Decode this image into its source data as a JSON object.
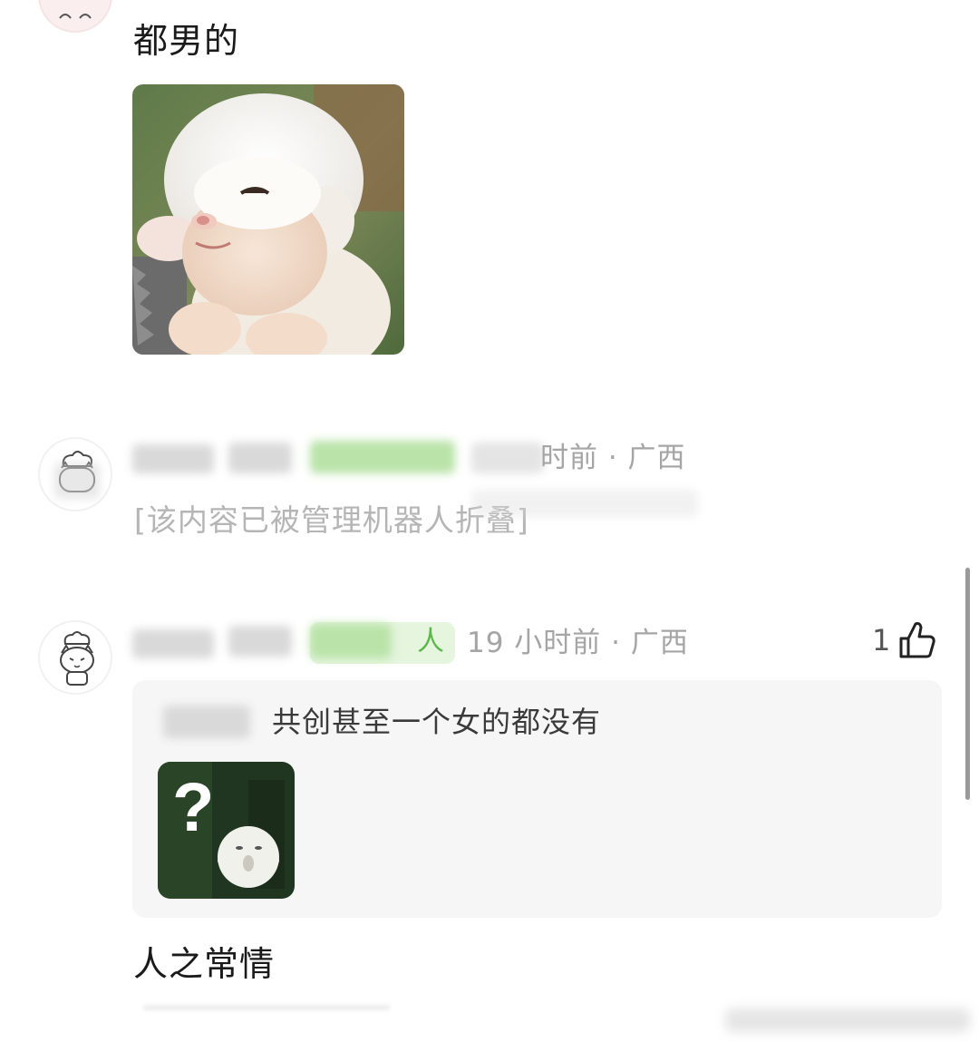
{
  "comment_top": {
    "text": "都男的"
  },
  "comment_folded": {
    "meta_visible": "时前 · 广西",
    "folded_text": "[该内容已被管理机器人折叠]"
  },
  "comment_reply": {
    "tag_visible": "人",
    "time_location": "19 小时前 · 广西",
    "like_count": "1",
    "quoted_text": "共创甚至一个女的都没有",
    "reply_text": "人之常情"
  },
  "colors": {
    "meta_gray": "#a5a5a5",
    "tag_green": "#5bb84a",
    "reply_bg": "#f6f6f6"
  },
  "icons": [
    "cat-chef-avatar-icon",
    "thumbs-up-icon",
    "sheep-image",
    "question-ghost-image"
  ]
}
